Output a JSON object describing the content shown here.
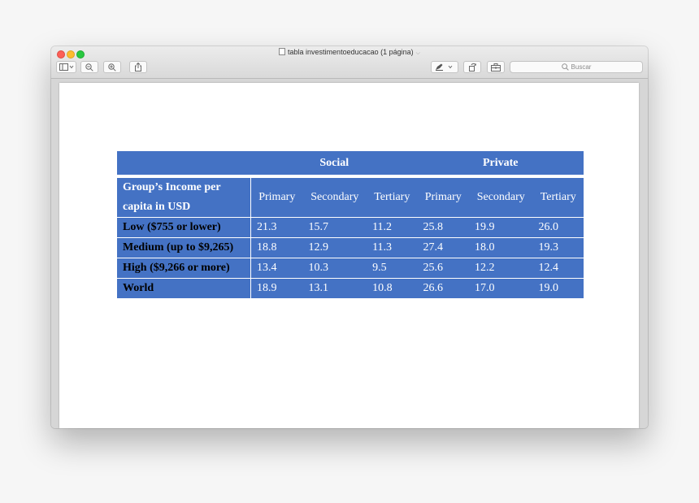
{
  "window": {
    "title": "tabla investimentoeducacao (1 página)"
  },
  "toolbar": {
    "search_placeholder": "Buscar"
  },
  "table": {
    "group_headers": [
      "Social",
      "Private"
    ],
    "row_header_line1": "Group’s Income per",
    "row_header_line2": "capita in USD",
    "sub_headers": [
      "Primary",
      "Secondary",
      "Tertiary",
      "Primary",
      "Secondary",
      "Tertiary"
    ],
    "rows": [
      {
        "label": "Low ($755 or lower)",
        "values": [
          "21.3",
          "15.7",
          "11.2",
          "25.8",
          "19.9",
          "26.0"
        ]
      },
      {
        "label": "Medium (up to $9,265)",
        "values": [
          "18.8",
          "12.9",
          "11.3",
          "27.4",
          "18.0",
          "19.3"
        ]
      },
      {
        "label": "High ($9,266 or more)",
        "values": [
          "13.4",
          "10.3",
          "9.5",
          "25.6",
          "12.2",
          "12.4"
        ]
      },
      {
        "label": "World",
        "values": [
          "18.9",
          "13.1",
          "10.8",
          "26.6",
          "17.0",
          "19.0"
        ]
      }
    ]
  }
}
